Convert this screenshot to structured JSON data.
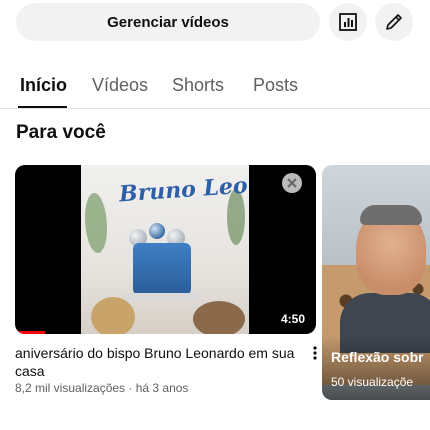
{
  "header": {
    "manage_videos_label": "Gerenciar vídeos",
    "stats_icon": "analytics-icon",
    "edit_icon": "pencil-icon"
  },
  "tabs": [
    {
      "label": "Início",
      "active": true
    },
    {
      "label": "Vídeos",
      "active": false
    },
    {
      "label": "Shorts",
      "active": false
    },
    {
      "label": "Posts",
      "active": false
    }
  ],
  "section": {
    "title": "Para você"
  },
  "videos": [
    {
      "title": "aniversário do bispo Bruno Leonardo em sua casa",
      "meta": "8,2 mil visualizações · há 3 anos",
      "duration": "4:50",
      "thumbnail_text": "Bruno Leo",
      "watch_progress_percent": 10
    },
    {
      "title": "Reflexão sobr",
      "meta": "50 visualizaçõe"
    }
  ],
  "colors": {
    "accent": "#ff0000",
    "text_primary": "#0f0f0f",
    "text_secondary": "#606060",
    "chip_bg": "#f2f2f2"
  }
}
